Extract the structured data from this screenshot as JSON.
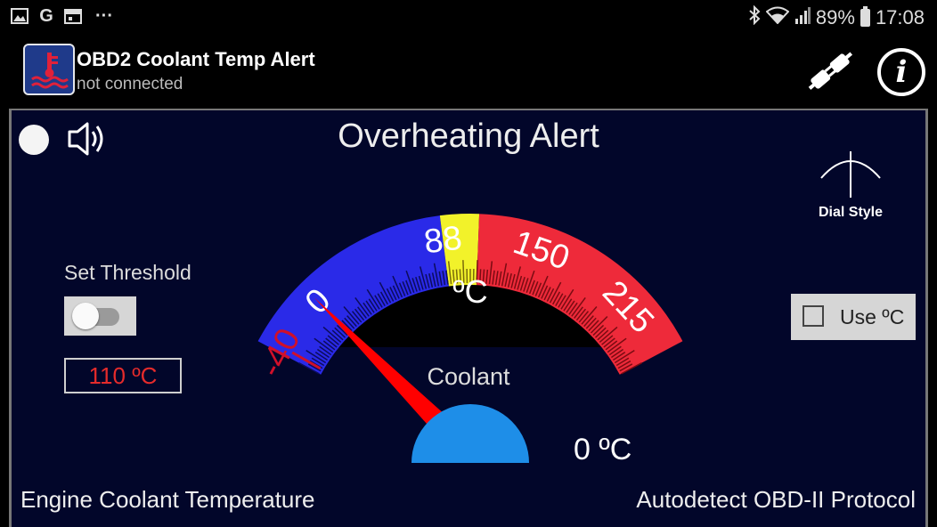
{
  "statusbar": {
    "left_icons": [
      "image-icon",
      "google-icon",
      "calendar-icon",
      "more-icon"
    ],
    "battery": "89%",
    "time": "17:08"
  },
  "app": {
    "title": "OBD2 Coolant Temp Alert",
    "status": "not connected"
  },
  "panel": {
    "title": "Overheating Alert",
    "dial_style_label": "Dial Style",
    "set_threshold_label": "Set Threshold",
    "threshold_value": "110 ºC",
    "threshold_enabled": false,
    "use_celsius_label": "Use ºC",
    "use_celsius_checked": false,
    "gauge": {
      "ticks": [
        "-40",
        "0",
        "88",
        "150",
        "215"
      ],
      "unit": "ºC",
      "label": "Coolant",
      "min": -40,
      "max": 250,
      "yellow_band": [
        88,
        110
      ],
      "red_band": [
        110,
        250
      ],
      "needle_value": 0
    },
    "readout": "0 ºC",
    "footer_left": "Engine Coolant Temperature",
    "footer_right": "Autodetect OBD-II Protocol"
  },
  "colors": {
    "panel_bg": "#02062a",
    "gauge_blue": "#2a2ae8",
    "gauge_yellow": "#f2f22a",
    "gauge_red": "#ee2a3a",
    "needle": "#ff0000",
    "hub": "#1e8ee8",
    "threshold_text": "#e52b2b"
  }
}
